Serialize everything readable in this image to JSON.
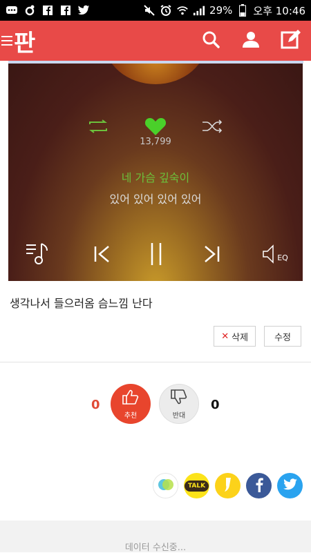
{
  "status_bar": {
    "battery": "29%",
    "time": "오후 10:46"
  },
  "app": {
    "logo": "판"
  },
  "player": {
    "like_count": "13,799",
    "lyric_line_1": "네 가슴 깊숙이",
    "lyric_line_2": "있어 있어 있어 있어",
    "eq_label": "EQ",
    "accent_color": "#6cc13c"
  },
  "post": {
    "text": "생각나서 들으러옴 슴느낌 난다"
  },
  "actions": {
    "delete_label": "삭제",
    "edit_label": "수정"
  },
  "votes": {
    "up_count": "0",
    "up_label": "추천",
    "down_count": "0",
    "down_label": "반대"
  },
  "share": {
    "kakaotalk_label": "TALK"
  },
  "footer": {
    "loading_text": "데이터 수신중..."
  }
}
